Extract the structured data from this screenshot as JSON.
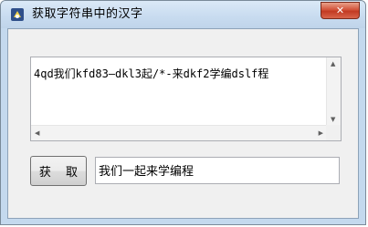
{
  "window": {
    "title": "获取字符串中的汉字",
    "close_label": "✕"
  },
  "input": {
    "value": "4qd我们kfd83—dkl3起/*-来dkf2学编dslf程"
  },
  "actions": {
    "extract_label": "获 取"
  },
  "output": {
    "value": "我们一起来学编程"
  },
  "icons": {
    "app": "app-icon",
    "close": "close-icon",
    "scroll_up": "arrow-up-icon",
    "scroll_down": "arrow-down-icon",
    "scroll_left": "arrow-left-icon",
    "scroll_right": "arrow-right-icon"
  },
  "colors": {
    "titlebar": "#c9dcf0",
    "close_button": "#d3533a",
    "client": "#f0f0f0"
  }
}
